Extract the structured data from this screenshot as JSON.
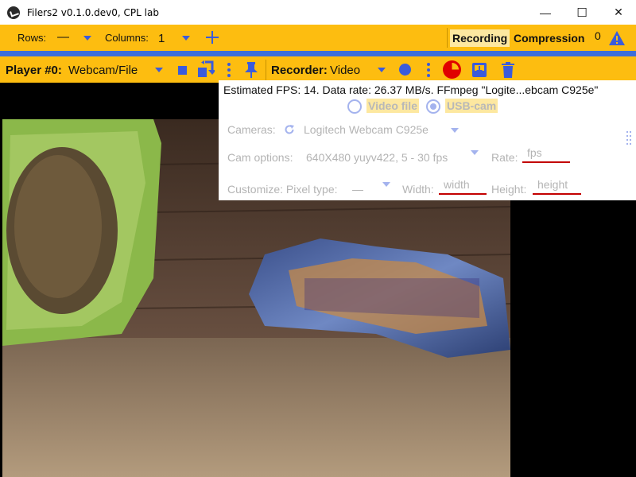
{
  "window": {
    "title": "Filers2 v0.1.0.dev0, CPL lab",
    "minimize_glyph": "—",
    "maximize_glyph": "☐",
    "close_glyph": "✕"
  },
  "toolbar1": {
    "rows_label": "Rows:",
    "rows_value": "—",
    "columns_label": "Columns:",
    "columns_value": "1",
    "recording_tab": "Recording",
    "compression_tab": "Compression",
    "warning_count": "0"
  },
  "toolbar2": {
    "player_label": "Player #0:",
    "player_source": "Webcam/File",
    "recorder_label": "Recorder:",
    "recorder_value": "Video"
  },
  "overlay": {
    "status": "Estimated FPS: 14. Data rate: 26.37 MB/s. FFmpeg \"Logite...ebcam C925e\"",
    "video_file_option": "Video file",
    "usb_cam_option": "USB-cam",
    "selected_source": "USB-cam",
    "cameras_label": "Cameras:",
    "camera_value": "Logitech Webcam C925e",
    "cam_options_label": "Cam options:",
    "cam_options_value": "640X480 yuyv422, 5 - 30 fps",
    "rate_label": "Rate:",
    "rate_placeholder": "fps",
    "customize_label": "Customize: Pixel type:",
    "pixel_type_value": "—",
    "width_label": "Width:",
    "width_placeholder": "width",
    "height_label": "Height:",
    "height_placeholder": "height"
  },
  "icons": {
    "rows_dropdown": "chevron-down-icon",
    "columns_dropdown": "chevron-down-icon",
    "add": "plus-icon",
    "warning": "warning-icon",
    "stop": "stop-icon",
    "swap": "swap-icon",
    "more": "more-vert-icon",
    "pin": "pin-icon",
    "record": "record-icon",
    "recording_status": "recording-status-icon",
    "save": "save-icon",
    "delete": "trash-icon",
    "refresh": "refresh-icon",
    "drag": "drag-handle-icon"
  },
  "colors": {
    "toolbar_bg": "#fdbd10",
    "accent_blue": "#3b5bdb",
    "strip_blue": "#3d6fd9",
    "record_red": "#e00000",
    "underline_red": "#c30000",
    "tab_highlight": "#fde8a0"
  }
}
